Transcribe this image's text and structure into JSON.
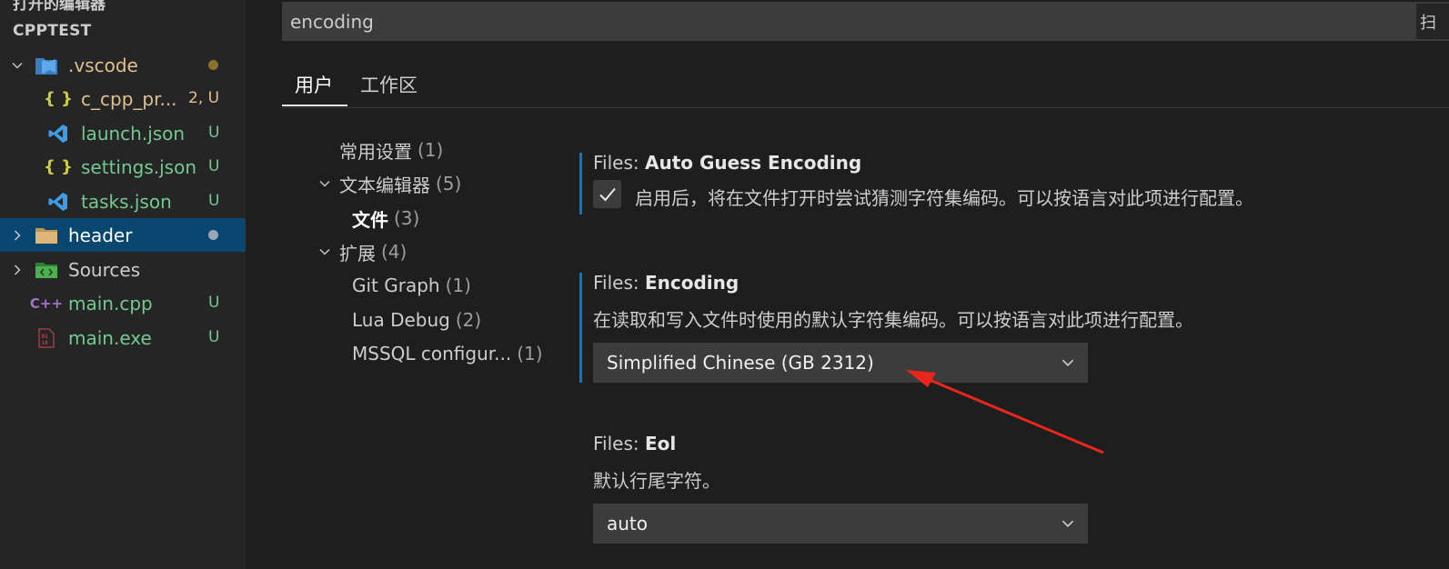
{
  "explorer": {
    "open_editors_title": "打开的编辑器",
    "folder_title": "CPPTEST",
    "items": [
      {
        "label": ".vscode",
        "badge": "",
        "color": "#e2c08d",
        "icon": "vscode-folder-icon",
        "expanded": true
      },
      {
        "label": "c_cpp_pr...",
        "badge": "2, U",
        "color": "#e2c08d",
        "icon": "json-braces-icon"
      },
      {
        "label": "launch.json",
        "badge": "U",
        "color": "#73c991",
        "icon": "vscode-logo-icon"
      },
      {
        "label": "settings.json",
        "badge": "U",
        "color": "#73c991",
        "icon": "json-braces-icon"
      },
      {
        "label": "tasks.json",
        "badge": "U",
        "color": "#73c991",
        "icon": "vscode-logo-icon"
      },
      {
        "label": "header",
        "badge": "",
        "color": "#ffffff",
        "icon": "folder-icon",
        "selected": true
      },
      {
        "label": "Sources",
        "badge": "",
        "color": "#cccccc",
        "icon": "source-folder-icon"
      },
      {
        "label": "main.cpp",
        "badge": "U",
        "color": "#73c991",
        "icon": "cpp-file-icon"
      },
      {
        "label": "main.exe",
        "badge": "U",
        "color": "#73c991",
        "icon": "binary-file-icon"
      }
    ]
  },
  "settings": {
    "search_value": "encoding",
    "search_end_glyph": "扫",
    "tabs": [
      {
        "label": "用户",
        "active": true
      },
      {
        "label": "工作区",
        "active": false
      }
    ],
    "toc": [
      {
        "label": "常用设置",
        "count": "(1)"
      },
      {
        "label": "文本编辑器",
        "count": "(5)"
      },
      {
        "label": "文件",
        "count": "(3)"
      },
      {
        "label": "扩展",
        "count": "(4)"
      },
      {
        "label": "Git Graph",
        "count": "(1)"
      },
      {
        "label": "Lua Debug",
        "count": "(2)"
      },
      {
        "label": "MSSQL configur...",
        "count": "(1)"
      }
    ],
    "items": [
      {
        "category": "Files: ",
        "name": "Auto Guess Encoding",
        "checkbox_checked": true,
        "checkbox_label": "启用后，将在文件打开时尝试猜测字符集编码。可以按语言对此项进行配置。"
      },
      {
        "category": "Files: ",
        "name": "Encoding",
        "description": "在读取和写入文件时使用的默认字符集编码。可以按语言对此项进行配置。",
        "value": "Simplified Chinese (GB 2312)"
      },
      {
        "category": "Files: ",
        "name": "Eol",
        "description": "默认行尾字符。",
        "value": "auto"
      }
    ]
  },
  "colors": {
    "accent": "#007acc",
    "selection": "#094771",
    "annotation_arrow": "#e8261c",
    "untracked": "#73c991",
    "modified": "#e2c08d"
  }
}
